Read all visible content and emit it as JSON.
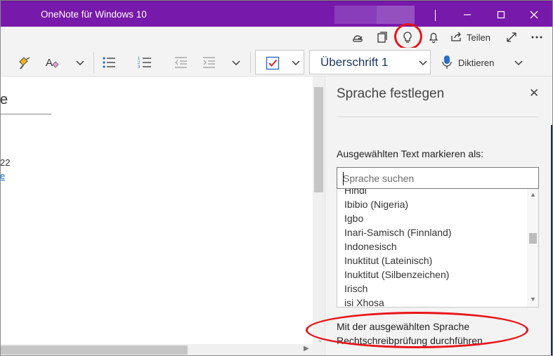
{
  "window": {
    "title": "OneNote für Windows 10"
  },
  "commandbar": {
    "share_label": "Teilen",
    "icons": [
      "sync-icon",
      "pages-icon",
      "lightbulb-icon",
      "bell-icon",
      "share-icon",
      "expand-icon",
      "more-icon"
    ]
  },
  "ribbon": {
    "style_value": "Überschrift 1",
    "dictate_label": "Diktieren"
  },
  "page": {
    "title_fragment": "e",
    "date_fragment": "22",
    "link_fragment": "e"
  },
  "language_pane": {
    "title": "Sprache festlegen",
    "mark_label": "Ausgewählten Text markieren als:",
    "search_placeholder": "Sprache suchen",
    "languages": [
      "Hindi",
      "Ibibio (Nigeria)",
      "Igbo",
      "Inari-Samisch (Finnland)",
      "Indonesisch",
      "Inuktitut (Lateinisch)",
      "Inuktitut (Silbenzeichen)",
      "Irisch",
      "isi Xhosa"
    ],
    "spellcheck_line1": "Mit der ausgewählten Sprache",
    "spellcheck_line2": "Rechtschreibprüfung durchführen"
  },
  "colors": {
    "titlebar": "#7719aa",
    "highlight_ring": "#e8141a",
    "style_text": "#1f3864",
    "link": "#1a6fc4"
  }
}
